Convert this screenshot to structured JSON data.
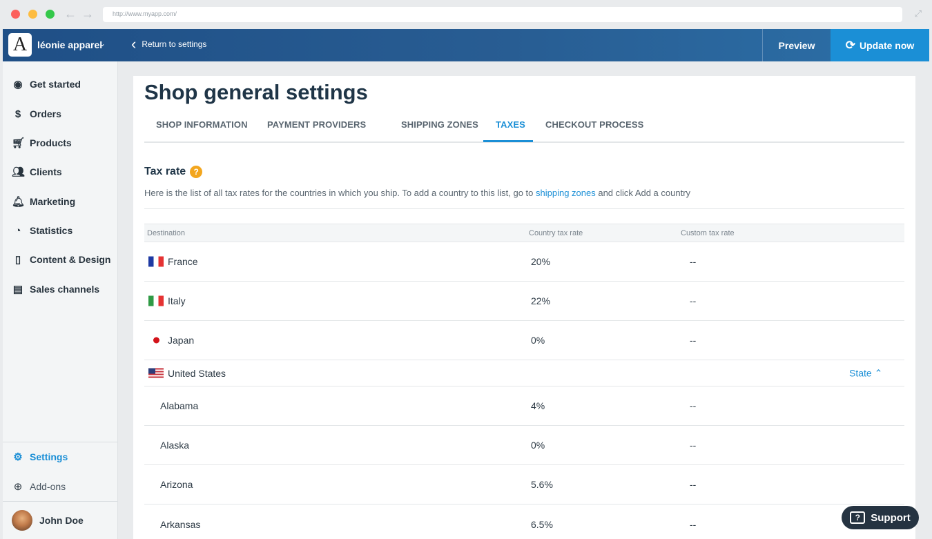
{
  "browser": {
    "url": "http://www.myapp.com/"
  },
  "topbar": {
    "logo_letter": "A",
    "shop_name": "léonie apparel",
    "back_label": "Return to settings",
    "preview_label": "Preview",
    "update_label": "Update now"
  },
  "sidebar": {
    "items": [
      {
        "label": "Get started",
        "icon": "check-circle-icon"
      },
      {
        "label": "Orders",
        "icon": "dollar-circle-icon"
      },
      {
        "label": "Products",
        "icon": "cart-icon"
      },
      {
        "label": "Clients",
        "icon": "people-icon"
      },
      {
        "label": "Marketing",
        "icon": "bell-icon"
      },
      {
        "label": "Statistics",
        "icon": "pie-chart-icon"
      },
      {
        "label": "Content & Design",
        "icon": "phone-icon"
      },
      {
        "label": "Sales channels",
        "icon": "store-icon"
      }
    ],
    "settings_label": "Settings",
    "addons_label": "Add-ons",
    "user_name": "John Doe"
  },
  "page": {
    "title": "Shop general settings",
    "tabs": [
      "SHOP INFORMATION",
      "PAYMENT PROVIDERS",
      "SHIPPING ZONES",
      "TAXES",
      "CHECKOUT PROCESS"
    ],
    "active_tab": "TAXES"
  },
  "tax": {
    "title": "Tax rate",
    "help_glyph": "?",
    "desc_before": "Here is the list of all tax rates for the countries in which you ship. To add a country to this list, go to ",
    "desc_link": "shipping zones",
    "desc_after": " and click Add a country",
    "columns": {
      "destination": "Destination",
      "country_rate": "Country tax rate",
      "custom_rate": "Custom tax rate"
    },
    "countries": [
      {
        "name": "France",
        "flag": "fr",
        "rate": "20%",
        "custom": "--"
      },
      {
        "name": "Italy",
        "flag": "it",
        "rate": "22%",
        "custom": "--"
      },
      {
        "name": "Japan",
        "flag": "jp",
        "rate": "0%",
        "custom": "--"
      }
    ],
    "us": {
      "name": "United States",
      "toggle_label": "State"
    },
    "states": [
      {
        "name": "Alabama",
        "rate": "4%",
        "custom": "--"
      },
      {
        "name": "Alaska",
        "rate": "0%",
        "custom": "--"
      },
      {
        "name": "Arizona",
        "rate": "5.6%",
        "custom": "--"
      },
      {
        "name": "Arkansas",
        "rate": "6.5%",
        "custom": "--"
      }
    ]
  },
  "support": {
    "label": "Support"
  },
  "colors": {
    "accent": "#1b8fd6",
    "topbar": "#285d93",
    "help": "#f3a61e"
  }
}
